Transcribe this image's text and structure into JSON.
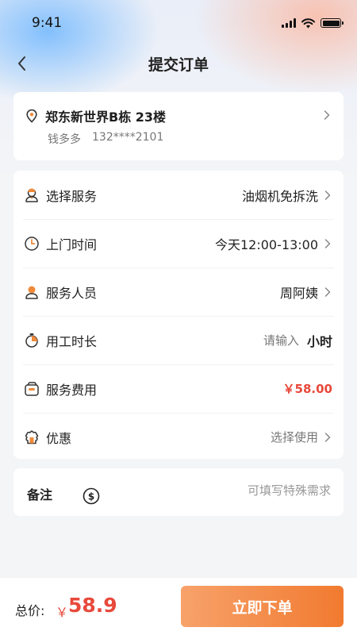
{
  "status_bar": {
    "time": "9:41"
  },
  "nav": {
    "title": "提交订单",
    "back_icon": "chevron-left-icon"
  },
  "address": {
    "line": "郑东新世界B栋 23楼",
    "name": "钱多多",
    "phone": "132****2101",
    "icon": "location-pin-icon"
  },
  "service_rows": [
    {
      "label": "选择服务",
      "value": "油烟机免拆洗",
      "icon": "worker-icon"
    },
    {
      "label": "上门时间",
      "value": "今天12:00-13:00",
      "icon": "clock-icon"
    },
    {
      "label": "服务人员",
      "value": "周阿姨",
      "icon": "person-icon"
    },
    {
      "label": "用工时长",
      "placeholder": "请输入",
      "unit": "小时",
      "icon": "stopwatch-icon"
    },
    {
      "label": "服务费用",
      "value": "￥58.00",
      "icon": "wallet-icon"
    },
    {
      "label": "优惠",
      "value": "选择使用",
      "icon": "coupon-icon"
    }
  ],
  "note": {
    "label": "备注",
    "placeholder": "可填写特殊需求",
    "icon": "dollar-coin-icon"
  },
  "footer": {
    "total_label": "总价:",
    "currency": "￥",
    "total_amount": "58.9",
    "submit_label": "立即下单"
  },
  "colors": {
    "accent_orange": "#f17a2f",
    "price_red": "#e8493b",
    "icon_orange": "#f08a3a"
  }
}
